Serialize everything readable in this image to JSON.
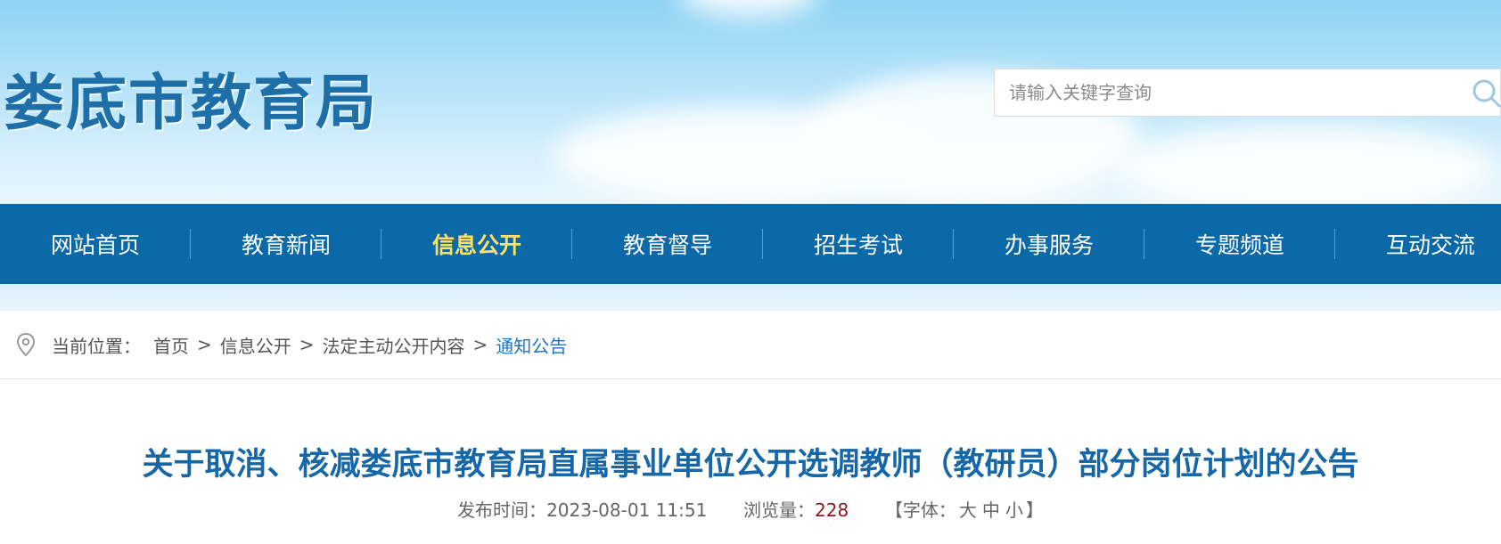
{
  "site": {
    "name": "娄底市教育局"
  },
  "search": {
    "placeholder": "请输入关键字查询"
  },
  "nav": {
    "items": [
      "网站首页",
      "教育新闻",
      "信息公开",
      "教育督导",
      "招生考试",
      "办事服务",
      "专题频道",
      "互动交流"
    ],
    "active_index": 2
  },
  "breadcrumb": {
    "prefix": "当前位置：",
    "links": [
      "首页",
      "信息公开",
      "法定主动公开内容"
    ],
    "current": "通知公告",
    "separator": ">"
  },
  "article": {
    "title": "关于取消、核减娄底市教育局直属事业单位公开选调教师（教研员）部分岗位计划的公告",
    "publish_label": "发布时间：",
    "publish_time": "2023-08-01 11:51",
    "views_label": "浏览量：",
    "views": "228",
    "font_open": "【字体：",
    "font_large": "大",
    "font_medium": "中",
    "font_small": "小",
    "font_close": "】"
  },
  "colors": {
    "nav_bg": "#0a69a6",
    "nav_active": "#ffe066",
    "title": "#1567a8",
    "crumb_current": "#1f73c4",
    "views": "#8b1a1a"
  }
}
